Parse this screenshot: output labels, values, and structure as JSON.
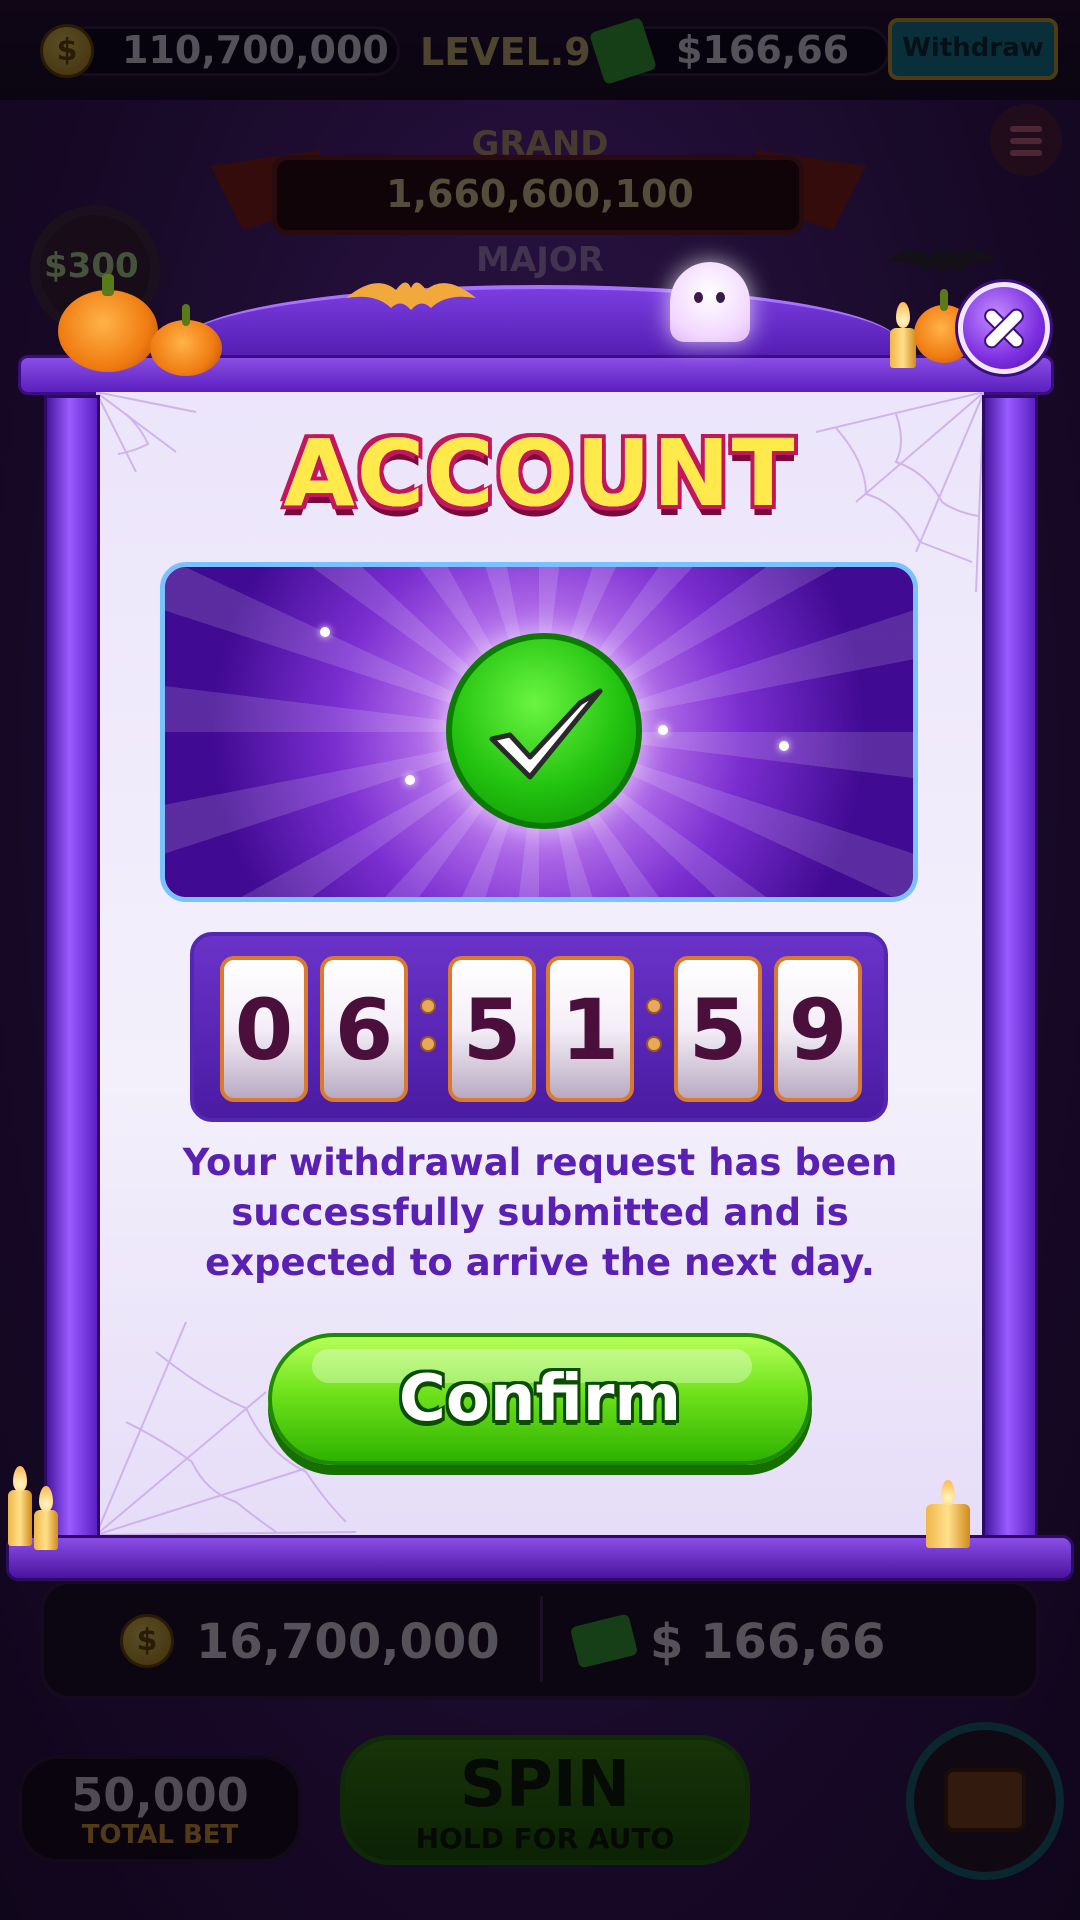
{
  "top_bar": {
    "coins": "110,700,000",
    "level": "LEVEL.9",
    "cash": "$166,66",
    "withdraw_label": "Withdraw",
    "coin_symbol": "$"
  },
  "jackpots": {
    "grand_label": "GRAND",
    "grand_value": "1,660,600,100",
    "major_label": "MAJOR",
    "side_badge": "$300"
  },
  "popup": {
    "title": "ACCOUNT",
    "timer": {
      "digits": [
        "0",
        "6",
        "5",
        "1",
        "5",
        "9"
      ]
    },
    "message": "Your withdrawal request has been successfully submitted and is expected to arrive the next day.",
    "confirm_label": "Confirm",
    "close_icon": "close-icon",
    "status_icon": "checkmark-icon"
  },
  "bottom_bar": {
    "coins": "16,700,000",
    "cash": "$ 166,66",
    "total_bet_value": "50,000",
    "total_bet_label": "TOTAL BET",
    "spin_label": "SPIN",
    "spin_sub_label": "HOLD FOR AUTO"
  },
  "colors": {
    "accent_purple": "#7d2fe0",
    "confirm_green": "#4ccf0f",
    "title_yellow": "#ffe94b",
    "message_purple": "#5a1fb3"
  }
}
